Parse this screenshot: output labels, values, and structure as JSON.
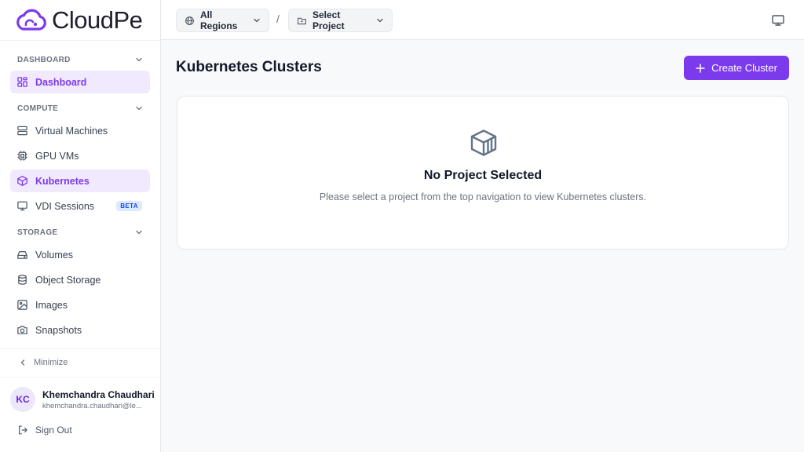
{
  "brand": {
    "name": "CloudPe",
    "accent": "#7c3aed"
  },
  "sidebar": {
    "sections": [
      {
        "title": "DASHBOARD",
        "items": [
          {
            "label": "Dashboard",
            "icon": "grid-icon",
            "active": true
          }
        ]
      },
      {
        "title": "COMPUTE",
        "items": [
          {
            "label": "Virtual Machines",
            "icon": "server-icon"
          },
          {
            "label": "GPU VMs",
            "icon": "chip-icon"
          },
          {
            "label": "Kubernetes",
            "icon": "cube-icon",
            "active": true
          },
          {
            "label": "VDI Sessions",
            "icon": "monitor-icon",
            "badge": "BETA"
          }
        ]
      },
      {
        "title": "STORAGE",
        "items": [
          {
            "label": "Volumes",
            "icon": "hard-drive-icon"
          },
          {
            "label": "Object Storage",
            "icon": "database-icon"
          },
          {
            "label": "Images",
            "icon": "image-icon"
          },
          {
            "label": "Snapshots",
            "icon": "camera-icon"
          }
        ]
      }
    ],
    "minimize_label": "Minimize",
    "user": {
      "initials": "KC",
      "name": "Khemchandra Chaudhari",
      "email": "khemchandra.chaudhari@le..."
    },
    "signout_label": "Sign Out"
  },
  "topbar": {
    "region_label": "All Regions",
    "separator": "/",
    "project_label": "Select Project"
  },
  "main": {
    "title": "Kubernetes Clusters",
    "create_button_label": "Create Cluster",
    "empty_state": {
      "title": "No Project Selected",
      "description": "Please select a project from the top navigation to view Kubernetes clusters."
    }
  }
}
